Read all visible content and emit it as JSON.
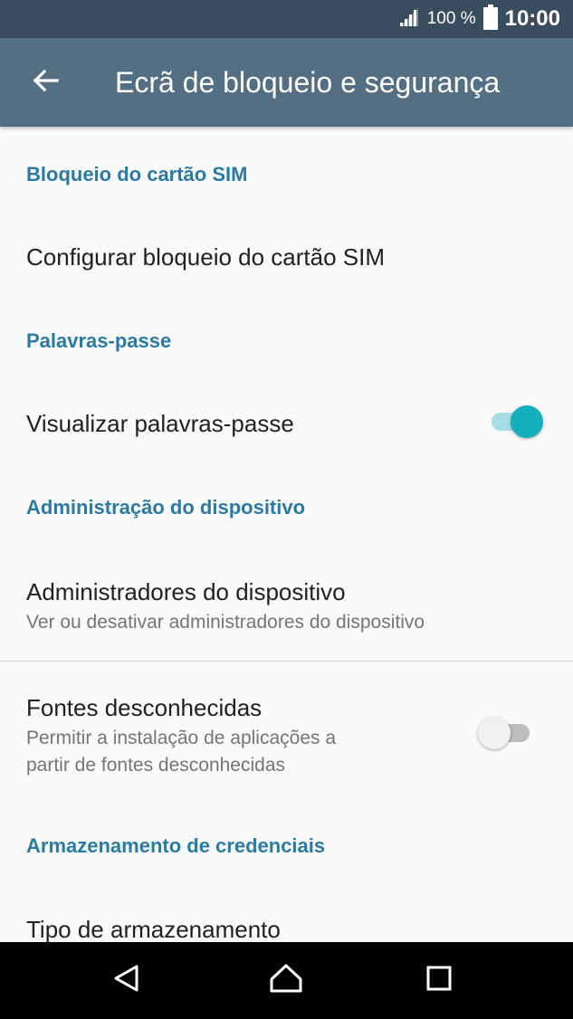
{
  "status_bar": {
    "battery_percent": "100 %",
    "time": "10:00",
    "icons": [
      "signal-icon",
      "battery-icon"
    ]
  },
  "app_bar": {
    "title": "Ecrã de bloqueio e segurança",
    "back_icon": "back-arrow-icon"
  },
  "sections": [
    {
      "header": "Bloqueio do cartão SIM",
      "items": [
        {
          "title": "Configurar bloqueio do cartão SIM"
        }
      ]
    },
    {
      "header": "Palavras-passe",
      "items": [
        {
          "title": "Visualizar palavras-passe",
          "toggle": true
        }
      ]
    },
    {
      "header": "Administração do dispositivo",
      "items": [
        {
          "title": "Administradores do dispositivo",
          "subtitle": "Ver ou desativar administradores do dispositivo"
        },
        {
          "title": "Fontes desconhecidas",
          "subtitle_lines": [
            "Permitir a instalação de aplicações a",
            "partir de fontes desconhecidas"
          ],
          "toggle": false
        }
      ]
    },
    {
      "header": "Armazenamento de credenciais",
      "items": [
        {
          "title": "Tipo de armazenamento"
        }
      ]
    }
  ],
  "nav_bar": {
    "icons": [
      "back-triangle-icon",
      "home-icon",
      "recents-icon"
    ]
  },
  "colors": {
    "status_bar": "#3a4d5e",
    "app_bar": "#546e84",
    "section_header": "#2a7aa6",
    "toggle_on": "#12b1bd"
  }
}
